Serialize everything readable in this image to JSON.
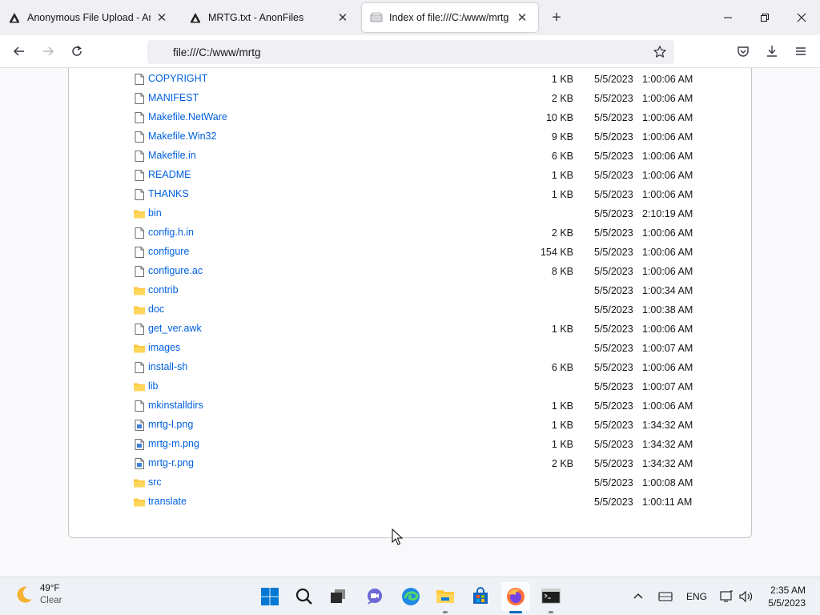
{
  "browser": {
    "tabs": [
      {
        "title": "Anonymous File Upload - Anon",
        "favicon": "anonfiles-icon",
        "active": false
      },
      {
        "title": "MRTG.txt - AnonFiles",
        "favicon": "anonfiles-icon",
        "active": false
      },
      {
        "title": "Index of file:///C:/www/mrtg",
        "favicon": "file-page-icon",
        "active": true
      }
    ],
    "url": "file:///C:/www/mrtg"
  },
  "listing": {
    "rows": [
      {
        "name": "COPYRIGHT",
        "type": "file",
        "size": "1 KB",
        "date": "5/5/2023",
        "time": "1:00:06 AM"
      },
      {
        "name": "MANIFEST",
        "type": "file",
        "size": "2 KB",
        "date": "5/5/2023",
        "time": "1:00:06 AM"
      },
      {
        "name": "Makefile.NetWare",
        "type": "file",
        "size": "10 KB",
        "date": "5/5/2023",
        "time": "1:00:06 AM"
      },
      {
        "name": "Makefile.Win32",
        "type": "file",
        "size": "9 KB",
        "date": "5/5/2023",
        "time": "1:00:06 AM"
      },
      {
        "name": "Makefile.in",
        "type": "file",
        "size": "6 KB",
        "date": "5/5/2023",
        "time": "1:00:06 AM"
      },
      {
        "name": "README",
        "type": "file",
        "size": "1 KB",
        "date": "5/5/2023",
        "time": "1:00:06 AM"
      },
      {
        "name": "THANKS",
        "type": "file",
        "size": "1 KB",
        "date": "5/5/2023",
        "time": "1:00:06 AM"
      },
      {
        "name": "bin",
        "type": "folder",
        "size": "",
        "date": "5/5/2023",
        "time": "2:10:19 AM"
      },
      {
        "name": "config.h.in",
        "type": "file",
        "size": "2 KB",
        "date": "5/5/2023",
        "time": "1:00:06 AM"
      },
      {
        "name": "configure",
        "type": "file",
        "size": "154 KB",
        "date": "5/5/2023",
        "time": "1:00:06 AM"
      },
      {
        "name": "configure.ac",
        "type": "file",
        "size": "8 KB",
        "date": "5/5/2023",
        "time": "1:00:06 AM"
      },
      {
        "name": "contrib",
        "type": "folder",
        "size": "",
        "date": "5/5/2023",
        "time": "1:00:34 AM"
      },
      {
        "name": "doc",
        "type": "folder",
        "size": "",
        "date": "5/5/2023",
        "time": "1:00:38 AM"
      },
      {
        "name": "get_ver.awk",
        "type": "file",
        "size": "1 KB",
        "date": "5/5/2023",
        "time": "1:00:06 AM"
      },
      {
        "name": "images",
        "type": "folder",
        "size": "",
        "date": "5/5/2023",
        "time": "1:00:07 AM"
      },
      {
        "name": "install-sh",
        "type": "file",
        "size": "6 KB",
        "date": "5/5/2023",
        "time": "1:00:06 AM"
      },
      {
        "name": "lib",
        "type": "folder",
        "size": "",
        "date": "5/5/2023",
        "time": "1:00:07 AM"
      },
      {
        "name": "mkinstalldirs",
        "type": "file",
        "size": "1 KB",
        "date": "5/5/2023",
        "time": "1:00:06 AM"
      },
      {
        "name": "mrtg-l.png",
        "type": "image",
        "size": "1 KB",
        "date": "5/5/2023",
        "time": "1:34:32 AM"
      },
      {
        "name": "mrtg-m.png",
        "type": "image",
        "size": "1 KB",
        "date": "5/5/2023",
        "time": "1:34:32 AM"
      },
      {
        "name": "mrtg-r.png",
        "type": "image",
        "size": "2 KB",
        "date": "5/5/2023",
        "time": "1:34:32 AM"
      },
      {
        "name": "src",
        "type": "folder",
        "size": "",
        "date": "5/5/2023",
        "time": "1:00:08 AM"
      },
      {
        "name": "translate",
        "type": "folder",
        "size": "",
        "date": "5/5/2023",
        "time": "1:00:11 AM"
      }
    ]
  },
  "taskbar": {
    "weather": {
      "temp": "49°F",
      "condition": "Clear",
      "icon": "moon-icon"
    },
    "apps": [
      "windows-start-icon",
      "search-icon",
      "task-view-icon",
      "chat-icon",
      "edge-icon",
      "file-explorer-icon",
      "store-icon",
      "firefox-icon",
      "terminal-icon"
    ],
    "tray": {
      "language": "ENG"
    },
    "clock": {
      "time": "2:35 AM",
      "date": "5/5/2023"
    }
  },
  "colors": {
    "link": "#0060df",
    "folder": "#ffc83d",
    "accent": "#0067c0"
  }
}
